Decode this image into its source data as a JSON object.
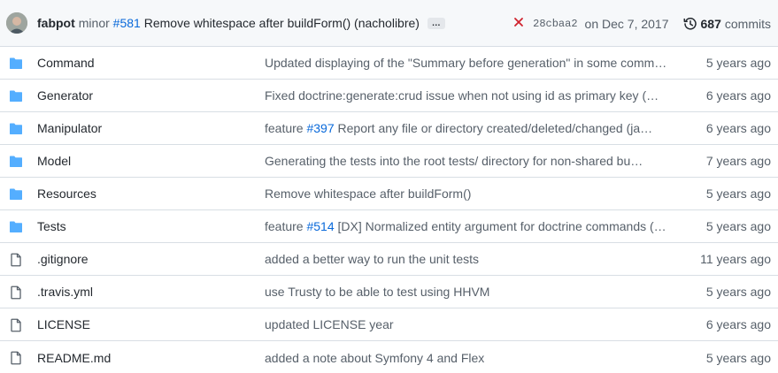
{
  "latest_commit": {
    "author": "fabpot",
    "message_prefix": "minor",
    "pr": "#581",
    "message_rest": "Remove whitespace after buildForm() (nacholibre)",
    "ellipsis": "…",
    "status_icon": "x-icon",
    "sha": "28cbaa2",
    "date": "on Dec 7, 2017",
    "commits_count": "687",
    "commits_label": "commits"
  },
  "files": [
    {
      "type": "dir",
      "name": "Command",
      "message": "Updated displaying of the \"Summary before generation\" in some comm…",
      "pr": "",
      "message_after": "",
      "age": "5 years ago"
    },
    {
      "type": "dir",
      "name": "Generator",
      "message": "Fixed doctrine:generate:crud issue when not using id as primary key (…",
      "pr": "",
      "message_after": "",
      "age": "6 years ago"
    },
    {
      "type": "dir",
      "name": "Manipulator",
      "message": "feature ",
      "pr": "#397",
      "message_after": " Report any file or directory created/deleted/changed (ja…",
      "age": "6 years ago"
    },
    {
      "type": "dir",
      "name": "Model",
      "message": "Generating the tests into the root tests/ directory for non-shared bu…",
      "pr": "",
      "message_after": "",
      "age": "7 years ago"
    },
    {
      "type": "dir",
      "name": "Resources",
      "message": "Remove whitespace after buildForm()",
      "pr": "",
      "message_after": "",
      "age": "5 years ago"
    },
    {
      "type": "dir",
      "name": "Tests",
      "message": "feature ",
      "pr": "#514",
      "message_after": " [DX] Normalized entity argument for doctrine commands (…",
      "age": "5 years ago"
    },
    {
      "type": "file",
      "name": ".gitignore",
      "message": "added a better way to run the unit tests",
      "pr": "",
      "message_after": "",
      "age": "11 years ago"
    },
    {
      "type": "file",
      "name": ".travis.yml",
      "message": "use Trusty to be able to test using HHVM",
      "pr": "",
      "message_after": "",
      "age": "5 years ago"
    },
    {
      "type": "file",
      "name": "LICENSE",
      "message": "updated LICENSE year",
      "pr": "",
      "message_after": "",
      "age": "6 years ago"
    },
    {
      "type": "file",
      "name": "README.md",
      "message": "added a note about Symfony 4 and Flex",
      "pr": "",
      "message_after": "",
      "age": "5 years ago"
    }
  ],
  "colors": {
    "folder": "#54aeff",
    "file": "#57606a",
    "link": "#0969da",
    "fail": "#cf222e"
  }
}
